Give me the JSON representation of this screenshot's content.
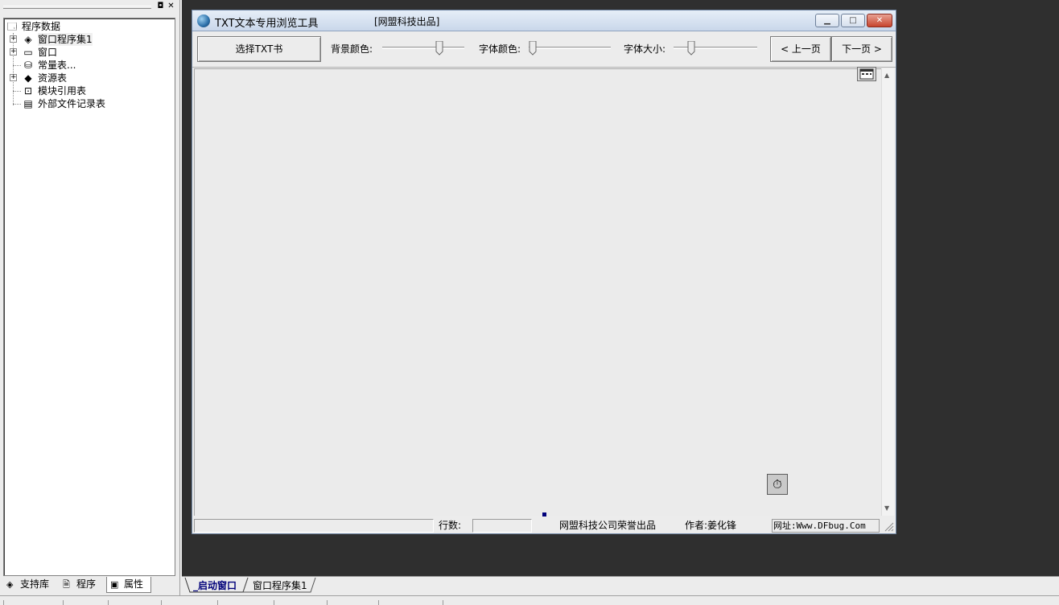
{
  "left_panel": {
    "tree": {
      "root": "程序数据",
      "items": [
        {
          "label": "窗口程序集1",
          "icon": "layers-icon",
          "expandable": true
        },
        {
          "label": "窗口",
          "icon": "window-icon",
          "expandable": true
        },
        {
          "label": "常量表...",
          "icon": "constants-icon",
          "expandable": false
        },
        {
          "label": "资源表",
          "icon": "resources-icon",
          "expandable": true
        },
        {
          "label": "模块引用表",
          "icon": "module-icon",
          "expandable": false
        },
        {
          "label": "外部文件记录表",
          "icon": "file-record-icon",
          "expandable": false
        }
      ]
    },
    "tabs": [
      {
        "label": "支持库",
        "icon": "library-icon"
      },
      {
        "label": "程序",
        "icon": "program-icon",
        "active": true
      },
      {
        "label": "属性",
        "icon": "properties-icon"
      }
    ]
  },
  "designer_window": {
    "title": "TXT文本专用浏览工具",
    "subtitle": "[网盟科技出品]",
    "toolbar": {
      "select_button": "选择TXT书",
      "bg_color_label": "背景颜色:",
      "font_color_label": "字体颜色:",
      "font_size_label": "字体大小:",
      "prev_button": "< 上一页",
      "next_button": "下一页 >"
    },
    "sliders": {
      "bg_color": 0.72,
      "font_color": 0.0,
      "font_size": 0.18
    },
    "statusbar": {
      "lines_label": "行数:",
      "lines_value": "",
      "company": "网盟科技公司荣誉出品",
      "author": "作者:姜化锋",
      "website": "网址:Www.DFbug.Com"
    }
  },
  "doc_tabs": [
    {
      "label": "_启动窗口",
      "active": true
    },
    {
      "label": "窗口程序集1",
      "active": false
    }
  ],
  "colors": {
    "workspace": "#2f2f2f",
    "panel": "#ececec",
    "title_gradient_top": "#e6eef8",
    "close_button": "#c7452e"
  }
}
